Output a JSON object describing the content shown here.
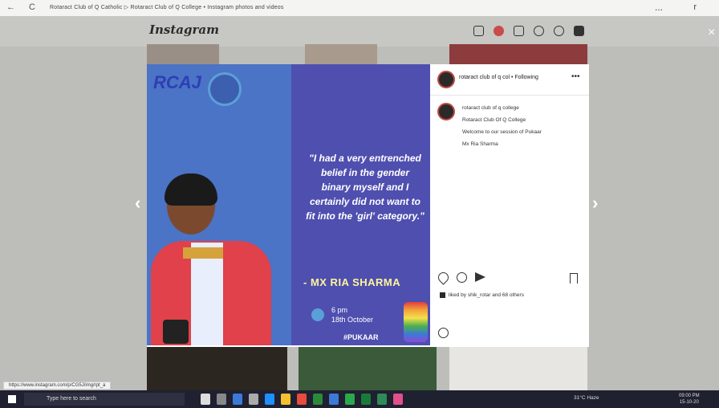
{
  "browser": {
    "back": "←",
    "reload": "C",
    "url": "Rotaract Club of Q Catholic ▷ Rotaract Club of Q College • Instagram photos and videos",
    "menu": "...",
    "user": "r"
  },
  "instagram": {
    "logo": "Instagram",
    "close": "×",
    "prev": "‹",
    "next": "›"
  },
  "poster": {
    "rca": "RCA",
    "rca_j": "J",
    "quote": "\"I had a very entrenched belief in the gender binary myself and I certainly did not want to fit into the 'girl' category.\"",
    "name": "- MX RIA SHARMA",
    "time_line1": "6 pm",
    "time_line2": "18th October",
    "hashtag": "#PUKAAR"
  },
  "post": {
    "account": "rotaract club of q col • Following",
    "more": "•••",
    "caption": [
      "rotaract club of q college",
      "Rotaract Club Of Q College",
      "Welcome to our session of Pukaar",
      "Mx Ria Sharma"
    ],
    "likes": "liked by shik_rotar and 68 others"
  },
  "status_url": "https://www.instagram.com/p/CG5J/img/rpt_a",
  "taskbar": {
    "search": "Type here to search",
    "tray": "31°C Haze",
    "time": "09:00 PM",
    "date": "15-10-20"
  }
}
